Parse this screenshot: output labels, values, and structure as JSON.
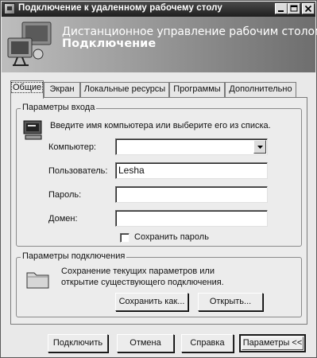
{
  "window": {
    "title": "Подключение к удаленному рабочему столу"
  },
  "banner": {
    "subtitle": "Дистанционное управление рабочим столом",
    "title": "Подключение"
  },
  "tabs": [
    {
      "label": "Общие",
      "active": true
    },
    {
      "label": "Экран",
      "active": false
    },
    {
      "label": "Локальные ресурсы",
      "active": false
    },
    {
      "label": "Программы",
      "active": false
    },
    {
      "label": "Дополнительно",
      "active": false
    }
  ],
  "login": {
    "legend": "Параметры входа",
    "prompt": "Введите имя компьютера или выберите его из списка.",
    "computer_label": "Компьютер:",
    "computer_value": "",
    "user_label": "Пользователь:",
    "user_value": "Lesha",
    "password_label": "Пароль:",
    "password_value": "",
    "domain_label": "Домен:",
    "domain_value": "",
    "save_password_label": "Сохранить пароль",
    "save_password_checked": false
  },
  "connection": {
    "legend": "Параметры подключения",
    "description": "Сохранение текущих параметров или открытие существующего подключения.",
    "save_as_label": "Сохранить как...",
    "open_label": "Открыть..."
  },
  "footer": {
    "connect_label": "Подключить",
    "cancel_label": "Отмена",
    "help_label": "Справка",
    "options_label": "Параметры <<"
  }
}
